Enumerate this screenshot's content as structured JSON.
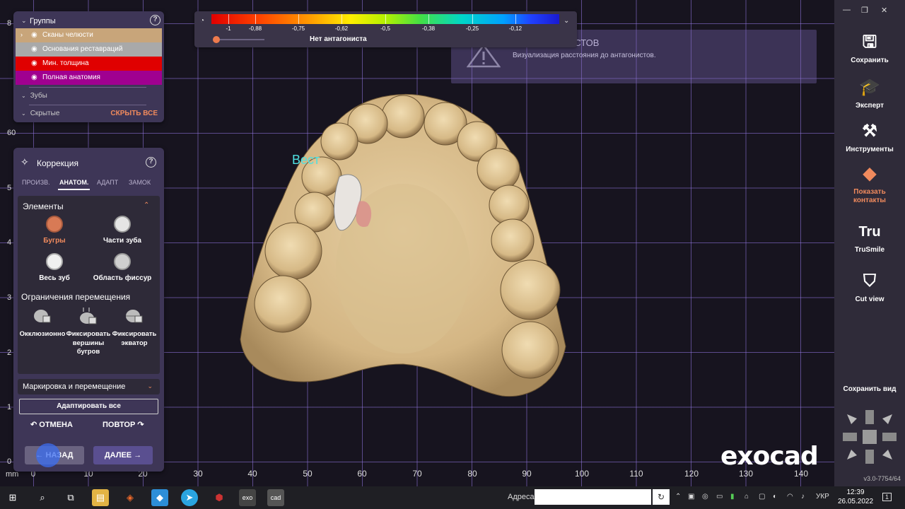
{
  "ruler": {
    "vertical": [
      "8",
      "60",
      "5",
      "4",
      "3",
      "2",
      "1",
      "0"
    ],
    "horizontal": [
      "0",
      "10",
      "20",
      "30",
      "40",
      "50",
      "60",
      "70",
      "80",
      "90",
      "100",
      "110",
      "120",
      "130",
      "140"
    ],
    "unit": "mm"
  },
  "color_scale": {
    "labels": [
      "-1",
      "-0,88",
      "-0,75",
      "-0,62",
      "-0,5",
      "-0,38",
      "-0,25",
      "-0,12"
    ],
    "no_antagonist": "Нет антагониста"
  },
  "warning": {
    "title": "ИСТОВ",
    "text": "Визуализация расстояния до антагонистов."
  },
  "groups": {
    "title": "Группы",
    "items": [
      {
        "label": "Сканы челюсти",
        "color": "#c8a57a"
      },
      {
        "label": "Основания реставраций",
        "color": "#a9a9a9"
      },
      {
        "label": "Мин. толщина",
        "color": "#e00000"
      },
      {
        "label": "Полная анатомия",
        "color": "#a00090"
      }
    ],
    "teeth": "Зубы",
    "hidden": "Скрытые",
    "hide_all": "СКРЫТЬ ВСЕ"
  },
  "correction": {
    "title": "Коррекция",
    "tabs": [
      "ПРОИЗВ.",
      "АНАТОМ.",
      "АДАПТ",
      "ЗАМОК"
    ],
    "active_tab": "АНАТОМ.",
    "elements_header": "Элементы",
    "elements": [
      "Бугры",
      "Части зуба",
      "Весь зуб",
      "Область фиссур"
    ],
    "constraints_header": "Ограничения перемещения",
    "constraints": [
      "Окклюзионно",
      "Фиксировать вершины бугров",
      "Фиксировать экватор"
    ],
    "marking": "Маркировка и перемещение",
    "adapt_all": "Адаптировать все",
    "undo": "ОТМЕНА",
    "redo": "ПОВТОР",
    "back": "НАЗАД",
    "next": "ДАЛЕЕ"
  },
  "sidebar": {
    "items": [
      {
        "label": "Сохранить",
        "icon": "save-icon"
      },
      {
        "label": "Эксперт",
        "icon": "graduation-cap-icon"
      },
      {
        "label": "Инструменты",
        "icon": "tools-icon"
      },
      {
        "label": "Показать контакты",
        "icon": "contacts-icon"
      },
      {
        "label": "TruSmile",
        "icon": "trusmile-icon"
      },
      {
        "label": "Cut view",
        "icon": "tooth-icon"
      }
    ],
    "save_view": "Сохранить вид",
    "version": "v3.0-7754/64"
  },
  "viewport_label": "Вест",
  "logo": "exocad",
  "taskbar": {
    "address_label": "Адреса",
    "address_value": "",
    "lang": "УКР",
    "time": "12:39",
    "date": "26.05.2022",
    "notifications": "1"
  }
}
